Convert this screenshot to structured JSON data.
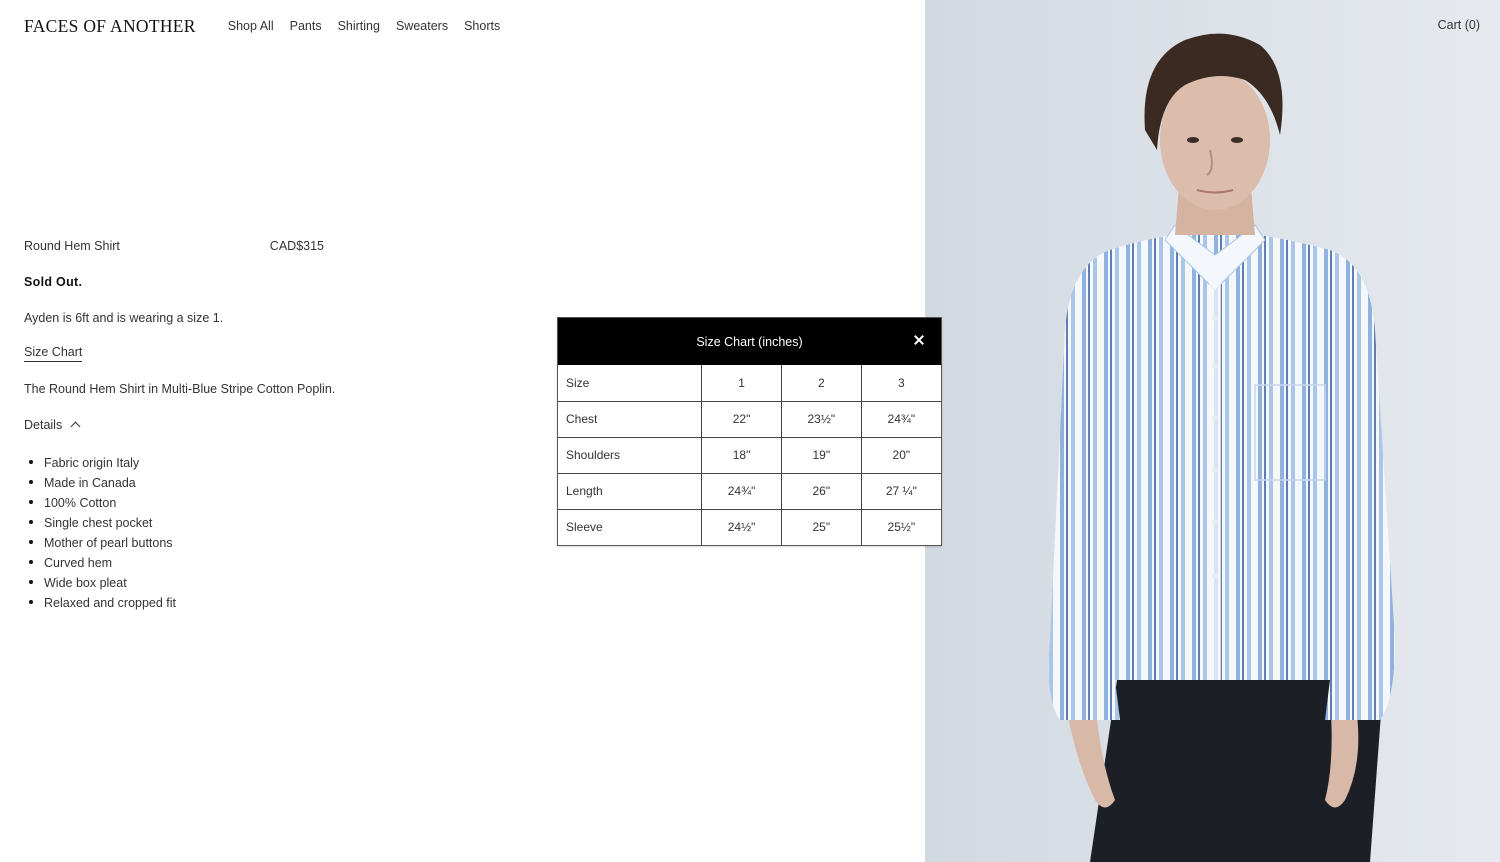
{
  "header": {
    "logo": "FACES OF ANOTHER",
    "nav": [
      "Shop All",
      "Pants",
      "Shirting",
      "Sweaters",
      "Shorts"
    ],
    "cart": "Cart (0)"
  },
  "product": {
    "name": "Round Hem Shirt",
    "price": "CAD$315",
    "status": "Sold Out.",
    "fit_note": "Ayden is 6ft and is wearing a size 1.",
    "size_chart_link": "Size Chart",
    "description": "The Round Hem Shirt in Multi-Blue Stripe Cotton Poplin.",
    "details_label": "Details",
    "details": [
      "Fabric origin Italy",
      "Made in Canada",
      "100% Cotton",
      "Single chest pocket",
      "Mother of pearl buttons",
      "Curved hem",
      "Wide box pleat",
      "Relaxed and cropped fit"
    ]
  },
  "size_chart": {
    "title": "Size Chart (inches)",
    "rows": [
      [
        "Size",
        "1",
        "2",
        "3"
      ],
      [
        "Chest",
        "22\"",
        "23½\"",
        "24¾\""
      ],
      [
        "Shoulders",
        "18\"",
        "19\"",
        "20\""
      ],
      [
        "Length",
        "24¾\"",
        "26\"",
        "27 ¼\""
      ],
      [
        "Sleeve",
        "24½\"",
        "25\"",
        "25½\""
      ]
    ]
  },
  "colors": {
    "modal_header": "#000000",
    "photo_bg": "#dde2e8",
    "shirt_stripe": "#8fb3de",
    "trousers": "#1c1f26"
  }
}
